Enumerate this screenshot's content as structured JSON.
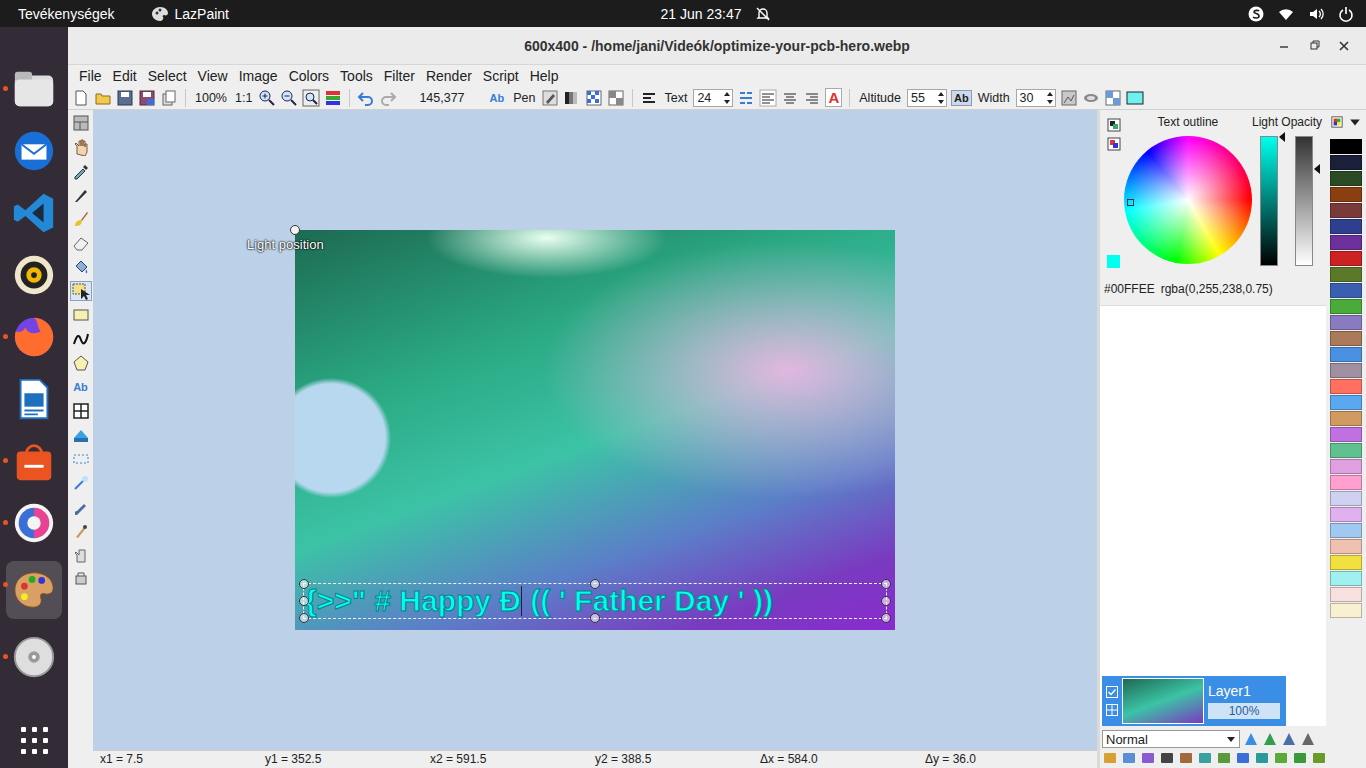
{
  "top_bar": {
    "activities": "Tevékenységek",
    "app": "LazPaint",
    "clock": "21 Jun 23:47"
  },
  "dock": [
    {
      "running": true,
      "selected": false
    },
    {
      "running": false,
      "selected": false
    },
    {
      "running": false,
      "selected": false
    },
    {
      "running": false,
      "selected": false
    },
    {
      "running": true,
      "selected": false
    },
    {
      "running": false,
      "selected": false
    },
    {
      "running": true,
      "selected": false
    },
    {
      "running": true,
      "selected": false
    },
    {
      "running": true,
      "selected": true
    },
    {
      "running": true,
      "selected": false
    }
  ],
  "window": {
    "title": "600x400 - /home/jani/Videók/optimize-your-pcb-hero.webp"
  },
  "menu": [
    "File",
    "Edit",
    "Select",
    "View",
    "Image",
    "Colors",
    "Tools",
    "Filter",
    "Render",
    "Script",
    "Help"
  ],
  "toolbar": {
    "zoom": "100%",
    "actual_size": "1:1",
    "position": "145,377",
    "text_style_icon": "Ab",
    "pen_label": "Pen",
    "text_label": "Text",
    "font_size": "24",
    "outline_icon": "A",
    "altitude_label": "Altitude",
    "altitude": "55",
    "shadow_icon": "Ab",
    "width_label": "Width",
    "width": "30"
  },
  "tools": [
    {
      "kind": "layout",
      "selected": false
    },
    {
      "kind": "hand",
      "selected": false
    },
    {
      "kind": "picker",
      "selected": false
    },
    {
      "kind": "pen",
      "selected": false
    },
    {
      "kind": "brush",
      "selected": false
    },
    {
      "kind": "eraser",
      "selected": false
    },
    {
      "kind": "fill",
      "selected": false
    },
    {
      "kind": "select",
      "selected": true
    },
    {
      "kind": "rect",
      "selected": false
    },
    {
      "kind": "curve",
      "selected": false
    },
    {
      "kind": "polygon",
      "selected": false
    },
    {
      "kind": "text",
      "label": "Ab",
      "selected": false
    },
    {
      "kind": "deform",
      "selected": false
    },
    {
      "kind": "phong",
      "selected": false
    },
    {
      "kind": "dots",
      "selected": false
    },
    {
      "kind": "wand",
      "selected": false
    },
    {
      "kind": "pencil",
      "selected": false
    },
    {
      "kind": "smudge",
      "selected": false
    },
    {
      "kind": "clone",
      "selected": false
    },
    {
      "kind": "stamp",
      "selected": false
    }
  ],
  "canvas": {
    "light_label": "Light position",
    "text_before_cursor": "{>>\" # Happy Đ",
    "text_after_cursor": " (( ' Father Day ' ))"
  },
  "color_panel": {
    "outline_label": "Text outline",
    "opacity_label": "Light Opacity",
    "hex": "#00FFEE",
    "rgba": "rgba(0,255,238,0.75)",
    "lightness_level": 1,
    "opacity_level": 0.75
  },
  "layers": [
    {
      "name": "Layer1",
      "opacity": "100%",
      "opacity_level": 1,
      "visible": true,
      "selected": true
    }
  ],
  "blend_mode": "Normal",
  "status_bar": [
    "x1 = 7.5",
    "y1 = 352.5",
    "x2 = 591.5",
    "y2 = 388.5",
    "Δx = 584.0",
    "Δy = 36.0"
  ],
  "palette": [
    {
      "color": "#000000"
    },
    {
      "color": "#1a1f3a"
    },
    {
      "color": "#2a4a24"
    },
    {
      "color": "#8b3e10"
    },
    {
      "color": "#7a3a3a"
    },
    {
      "color": "#2e3f8f"
    },
    {
      "color": "#6d2f9a"
    },
    {
      "color": "#cc2222"
    },
    {
      "color": "#5a7a2a"
    },
    {
      "color": "#3a5fb0"
    },
    {
      "color": "#4aaa3a"
    },
    {
      "color": "#8a7ac0"
    },
    {
      "color": "#aa7a5a"
    },
    {
      "color": "#4a90e0"
    },
    {
      "color": "#a08fa0"
    },
    {
      "color": "#ff7060"
    },
    {
      "color": "#5aa8f0"
    },
    {
      "color": "#d09a60"
    },
    {
      "color": "#c070e0"
    },
    {
      "color": "#60c090"
    },
    {
      "color": "#e0a0e0"
    },
    {
      "color": "#ffa0d0"
    },
    {
      "color": "#d0d0f0"
    },
    {
      "color": "#e0b0f0"
    },
    {
      "color": "#a0c8f0"
    },
    {
      "color": "#f0c0b0"
    },
    {
      "color": "#f0e040"
    },
    {
      "color": "#a0f0f0"
    },
    {
      "color": "#f8e0e0"
    },
    {
      "color": "#f8f0d0"
    }
  ]
}
